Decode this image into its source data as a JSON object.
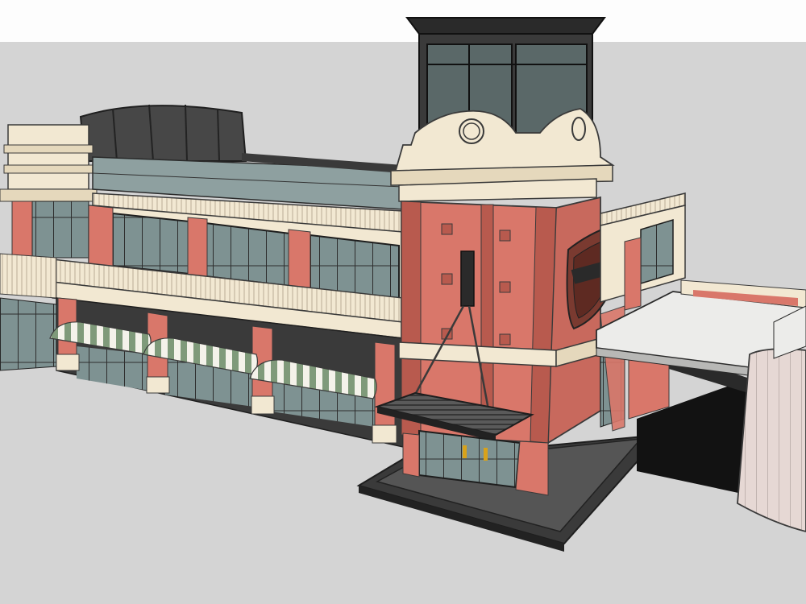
{
  "scene": {
    "view": "3d-model-viewport",
    "subject": "building",
    "colors": {
      "sky": "#fdfdfd",
      "ground": "#d4d4d4",
      "brick": "#d9776a",
      "brick_dark": "#b85a4e",
      "trim": "#f2e8d2",
      "dark_roof": "#3a3a3a",
      "glass": "#7e9292",
      "awning_green": "#7f9a7a",
      "awning_white": "#f4f2ea",
      "canopy": "#ececea",
      "shield": "#7a3a30",
      "door_handle": "#d8a21a"
    }
  }
}
